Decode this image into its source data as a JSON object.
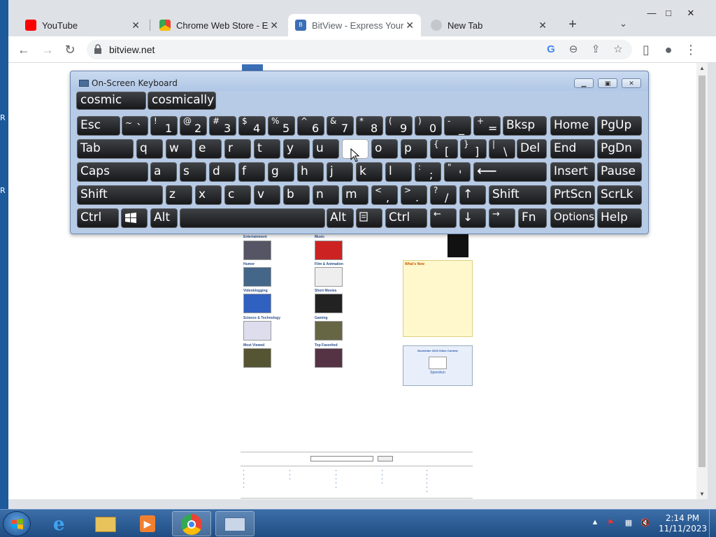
{
  "browser": {
    "tabs": [
      {
        "title": "YouTube",
        "favicon": "youtube-icon"
      },
      {
        "title": "Chrome Web Store - Ext",
        "favicon": "chrome-web-store-icon"
      },
      {
        "title": "BitView - Express Yourse",
        "favicon": "bitview-icon"
      },
      {
        "title": "New Tab",
        "favicon": "new-tab-icon"
      }
    ],
    "new_tab_label": "+",
    "url": "bitview.net"
  },
  "osk": {
    "title": "On-Screen Keyboard",
    "suggestions": [
      "cosmic",
      "cosmically"
    ],
    "keys": {
      "esc": "Esc",
      "bksp": "Bksp",
      "home": "Home",
      "pgup": "PgUp",
      "tab": "Tab",
      "del": "Del",
      "end": "End",
      "pgdn": "PgDn",
      "caps": "Caps",
      "insert": "Insert",
      "pause": "Pause",
      "shift_l": "Shift",
      "shift_r": "Shift",
      "prtscn": "PrtScn",
      "scrlk": "ScrLk",
      "ctrl_l": "Ctrl",
      "alt_l": "Alt",
      "alt_r": "Alt",
      "ctrl_r": "Ctrl",
      "fn": "Fn",
      "options": "Options",
      "help": "Help"
    },
    "letters_row1": [
      "q",
      "w",
      "e",
      "r",
      "t",
      "y",
      "u",
      "",
      "o",
      "p"
    ],
    "letters_row2": [
      "a",
      "s",
      "d",
      "f",
      "g",
      "h",
      "j",
      "k",
      "l"
    ],
    "letters_row3": [
      "z",
      "x",
      "c",
      "v",
      "b",
      "n",
      "m"
    ],
    "number_keys": [
      {
        "up": "~",
        "dn": "`"
      },
      {
        "up": "!",
        "dn": "1"
      },
      {
        "up": "@",
        "dn": "2"
      },
      {
        "up": "#",
        "dn": "3"
      },
      {
        "up": "$",
        "dn": "4"
      },
      {
        "up": "%",
        "dn": "5"
      },
      {
        "up": "^",
        "dn": "6"
      },
      {
        "up": "&",
        "dn": "7"
      },
      {
        "up": "*",
        "dn": "8"
      },
      {
        "up": "(",
        "dn": "9"
      },
      {
        "up": ")",
        "dn": "0"
      },
      {
        "up": "-",
        "dn": "_"
      },
      {
        "up": "+",
        "dn": "="
      }
    ],
    "bracket_keys": [
      {
        "up": "{",
        "dn": "["
      },
      {
        "up": "}",
        "dn": "]"
      },
      {
        "up": "|",
        "dn": "\\"
      }
    ],
    "semi_keys": [
      {
        "up": ":",
        "dn": ";"
      },
      {
        "up": "\"",
        "dn": "'"
      }
    ],
    "punct_keys": [
      {
        "up": "<",
        "dn": ","
      },
      {
        "up": ">",
        "dn": "."
      },
      {
        "up": "?",
        "dn": "/"
      }
    ],
    "arrows": {
      "up": "↑",
      "left": "←",
      "down": "↓",
      "right": "→",
      "enter": "⟵"
    }
  },
  "page": {
    "categories": [
      "Entertainment",
      "Music",
      "Humor",
      "Film & Animation",
      "Videoblogging",
      "Short Movies",
      "Science & Technology",
      "Gaming",
      "Most Viewed",
      "Top Favorited"
    ],
    "whatsnew_title": "What's New",
    "contest_title": "November 2023 Video Contest",
    "contest_name": "Speedrun"
  },
  "taskbar": {
    "time": "2:14 PM",
    "date": "11/11/2023"
  }
}
